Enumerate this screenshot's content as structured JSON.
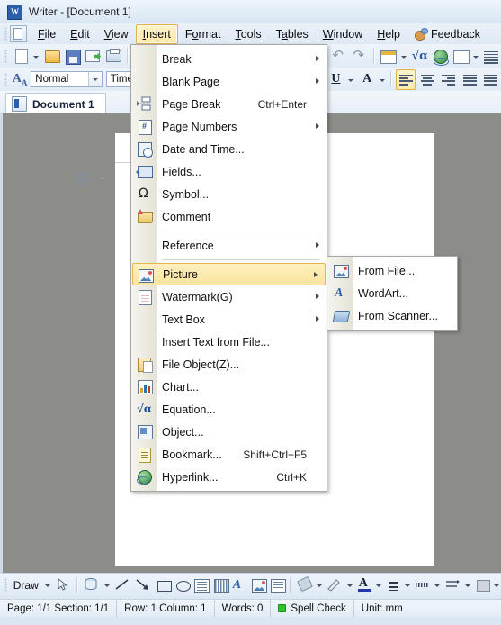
{
  "window": {
    "title": "Writer - [Document 1]",
    "app_icon": "writer-app-icon"
  },
  "menubar": {
    "items": [
      {
        "label": "File",
        "mnemonic": "F",
        "active": false
      },
      {
        "label": "Edit",
        "mnemonic": "E",
        "active": false
      },
      {
        "label": "View",
        "mnemonic": "V",
        "active": false
      },
      {
        "label": "Insert",
        "mnemonic": "I",
        "active": true
      },
      {
        "label": "Format",
        "mnemonic": "o",
        "active": false
      },
      {
        "label": "Tools",
        "mnemonic": "T",
        "active": false
      },
      {
        "label": "Tables",
        "mnemonic": "a",
        "active": false
      },
      {
        "label": "Window",
        "mnemonic": "W",
        "active": false
      },
      {
        "label": "Help",
        "mnemonic": "H",
        "active": false
      }
    ],
    "feedback": "Feedback"
  },
  "toolbar": {
    "style_combo_value": "Normal",
    "font_combo_value": "Time"
  },
  "doctab": {
    "label": "Document 1"
  },
  "insert_menu": {
    "items": [
      {
        "label": "Break",
        "icon": null,
        "accel": "",
        "submenu": true,
        "highlighted": false
      },
      {
        "label": "Blank Page",
        "icon": null,
        "accel": "",
        "submenu": true,
        "highlighted": false
      },
      {
        "label": "Page Break",
        "icon": "page-break-icon",
        "accel": "Ctrl+Enter",
        "submenu": false,
        "highlighted": false
      },
      {
        "label": "Page Numbers",
        "icon": "page-number-icon",
        "accel": "",
        "submenu": true,
        "highlighted": false
      },
      {
        "label": "Date and Time...",
        "icon": "date-time-icon",
        "accel": "",
        "submenu": false,
        "highlighted": false
      },
      {
        "label": "Fields...",
        "icon": "fields-icon",
        "accel": "",
        "submenu": false,
        "highlighted": false
      },
      {
        "label": "Symbol...",
        "icon": "symbol-omega-icon",
        "accel": "",
        "submenu": false,
        "highlighted": false
      },
      {
        "label": "Comment",
        "icon": "comment-icon",
        "accel": "",
        "submenu": false,
        "highlighted": false
      },
      {
        "divider": true
      },
      {
        "label": "Reference",
        "icon": null,
        "accel": "",
        "submenu": true,
        "highlighted": false
      },
      {
        "divider": true
      },
      {
        "label": "Picture",
        "icon": "picture-icon",
        "accel": "",
        "submenu": true,
        "highlighted": true
      },
      {
        "label": "Watermark(G)",
        "icon": "watermark-icon",
        "accel": "",
        "submenu": true,
        "highlighted": false
      },
      {
        "label": "Text Box",
        "icon": null,
        "accel": "",
        "submenu": true,
        "highlighted": false
      },
      {
        "label": "Insert Text from File...",
        "icon": null,
        "accel": "",
        "submenu": false,
        "highlighted": false
      },
      {
        "label": "File Object(Z)...",
        "icon": "file-object-icon",
        "accel": "",
        "submenu": false,
        "highlighted": false
      },
      {
        "label": "Chart...",
        "icon": "chart-icon",
        "accel": "",
        "submenu": false,
        "highlighted": false
      },
      {
        "label": "Equation...",
        "icon": "equation-icon",
        "accel": "",
        "submenu": false,
        "highlighted": false
      },
      {
        "label": "Object...",
        "icon": "object-icon",
        "accel": "",
        "submenu": false,
        "highlighted": false
      },
      {
        "label": "Bookmark...",
        "icon": "bookmark-icon",
        "accel": "Shift+Ctrl+F5",
        "submenu": false,
        "highlighted": false
      },
      {
        "label": "Hyperlink...",
        "icon": "hyperlink-icon",
        "accel": "Ctrl+K",
        "submenu": false,
        "highlighted": false
      }
    ]
  },
  "picture_submenu": {
    "items": [
      {
        "label": "From File...",
        "icon": "picture-icon"
      },
      {
        "label": "WordArt...",
        "icon": "wordart-icon"
      },
      {
        "label": "From Scanner...",
        "icon": "scanner-icon"
      }
    ]
  },
  "drawbar": {
    "draw_label": "Draw"
  },
  "statusbar": {
    "page": "Page: 1/1 Section: 1/1",
    "row_col": "Row: 1 Column: 1",
    "words": "Words: 0",
    "spell_check": "Spell Check",
    "unit": "Unit: mm"
  },
  "colors": {
    "menu_highlight": "#fbe49f",
    "highlight_border": "#e4b84d",
    "canvas_gray": "#8c8c89",
    "chrome_blue": "#e1ebf5",
    "spell_ok": "#2fc22f"
  }
}
